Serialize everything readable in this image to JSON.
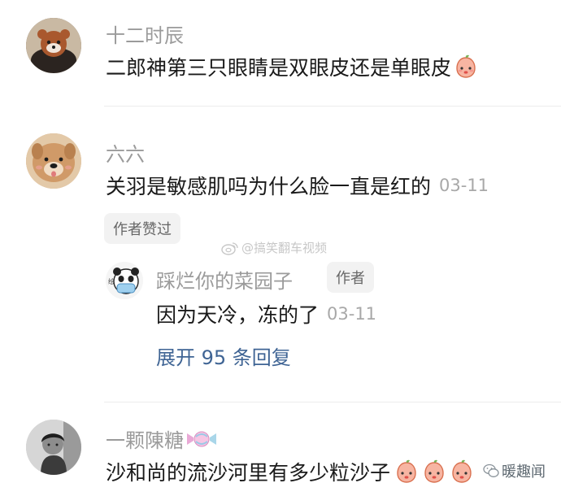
{
  "comments": [
    {
      "username": "十二时辰",
      "text": "二郎神第三只眼睛是双眼皮还是单眼皮",
      "emojis": [
        "peach-face"
      ]
    },
    {
      "username": "六六",
      "text": "关羽是敏感肌吗为什么脸一直是红的",
      "date": "03-11",
      "badge": "作者赞过",
      "reply": {
        "username": "踩烂你的菜园子",
        "author_tag": "作者",
        "text": "因为天冷，冻的了",
        "date": "03-11"
      },
      "expand_label": "展开 95 条回复"
    },
    {
      "username": "一颗陳糖",
      "text": "沙和尚的流沙河里有多少粒沙子",
      "emojis": [
        "peach-face",
        "peach-face",
        "peach-face"
      ]
    }
  ],
  "watermarks": {
    "weibo": "@搞笑翻车视频",
    "wechat": "暖趣闻"
  },
  "colors": {
    "username": "#9b9b9b",
    "link": "#3f6494",
    "divider": "#ececec"
  }
}
